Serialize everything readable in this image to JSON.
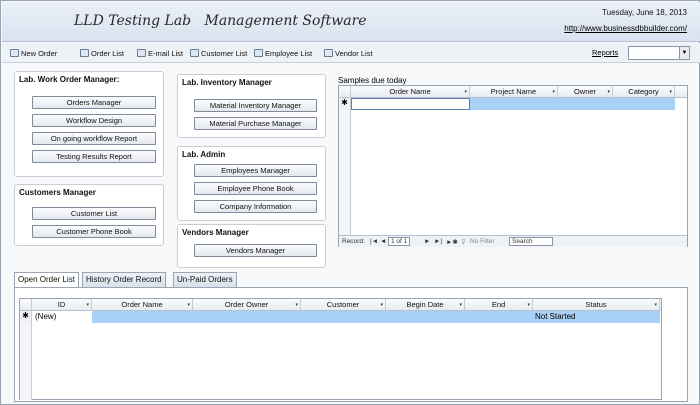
{
  "header": {
    "title": "LLD Testing Lab   Management Software",
    "date": "Tuesday, June 18, 2013",
    "link": "http://www.businessdbbuilder.com/"
  },
  "toolbar": {
    "items": [
      {
        "label": "New Order",
        "icon": "new-order-icon"
      },
      {
        "label": "Order List",
        "icon": "order-list-icon"
      },
      {
        "label": "E-mail List",
        "icon": "email-icon"
      },
      {
        "label": "Customer List",
        "icon": "customer-icon"
      },
      {
        "label": "Employee List",
        "icon": "employee-icon"
      },
      {
        "label": "Vendor List",
        "icon": "vendor-icon"
      }
    ],
    "reports_label": "Reports",
    "reports_value": "",
    "reports_arrow": "▼"
  },
  "work_order": {
    "title": "Lab. Work Order Manager:",
    "buttons": [
      "Orders Manager",
      "Workflow Design",
      "On going workflow Report",
      "Testing Results Report"
    ]
  },
  "customers": {
    "title": "Customers Manager",
    "buttons": [
      "Customer List",
      "Customer Phone Book"
    ]
  },
  "inventory": {
    "title": "Lab. Inventory Manager",
    "buttons": [
      "Material Inventory Manager",
      "Material Purchase Manager"
    ]
  },
  "admin": {
    "title": "Lab. Admin",
    "buttons": [
      "Employees Manager",
      "Employee Phone Book",
      "Company Information"
    ]
  },
  "vendors": {
    "title": "Vendors Manager",
    "buttons": [
      "Vendors Manager"
    ]
  },
  "samples": {
    "label": "Samples due today",
    "columns": [
      "Order Name",
      "Project Name",
      "Owner",
      "Category"
    ],
    "new_row_marker": "✱",
    "nav": {
      "record_label": "Record:",
      "first": "|◄",
      "prev": "◄",
      "position": "1 of 1",
      "next": "►",
      "last": "►|",
      "new": "►✱",
      "filter": "No Filter",
      "search": "Search"
    }
  },
  "tabs": [
    "Open Order List",
    "History Order Record",
    "Un-Paid Orders"
  ],
  "orders": {
    "columns": [
      "ID",
      "Order Name",
      "Order Owner",
      "Customer",
      "Begin Date",
      "End",
      "Status"
    ],
    "new_row_marker": "✱",
    "new_row_id": "(New)",
    "new_row_status": "Not Started",
    "dd": "▾"
  }
}
